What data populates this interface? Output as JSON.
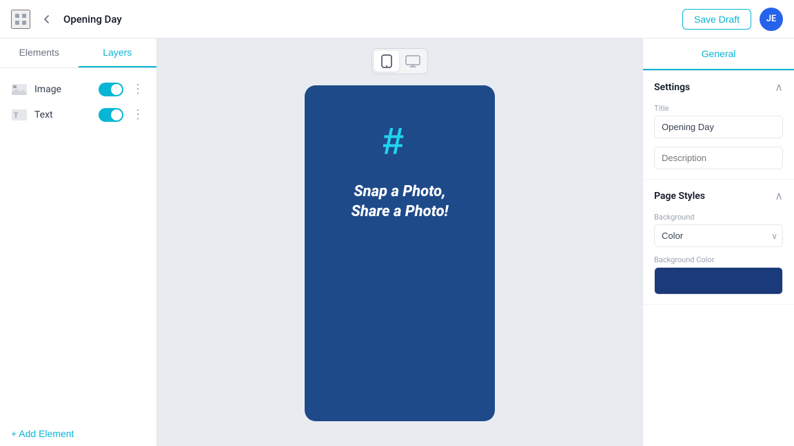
{
  "topbar": {
    "title": "Opening Day",
    "save_draft_label": "Save Draft",
    "avatar_initials": "JE"
  },
  "left_panel": {
    "tabs": [
      {
        "id": "elements",
        "label": "Elements"
      },
      {
        "id": "layers",
        "label": "Layers"
      }
    ],
    "active_tab": "layers",
    "layers": [
      {
        "id": "image",
        "name": "Image",
        "type": "image",
        "enabled": true
      },
      {
        "id": "text",
        "name": "Text",
        "type": "text",
        "enabled": true
      }
    ],
    "add_element_label": "+ Add Element"
  },
  "canvas": {
    "device_toolbar": [
      {
        "id": "mobile",
        "active": true
      },
      {
        "id": "desktop",
        "active": false
      }
    ],
    "phone": {
      "hash_symbol": "#",
      "headline_line1": "Snap a Photo,",
      "headline_line2": "Share a Photo!"
    }
  },
  "right_panel": {
    "active_tab": "General",
    "tabs": [
      "General"
    ],
    "settings_section": {
      "title": "Settings",
      "title_field_label": "Title",
      "title_field_value": "Opening Day",
      "description_field_label": "",
      "description_placeholder": "Description"
    },
    "page_styles_section": {
      "title": "Page Styles",
      "background_label": "Background",
      "background_value": "Color",
      "background_color_label": "Background Color",
      "background_color_hex": "#1a3a7a"
    }
  },
  "icons": {
    "grid": "⊞",
    "back_arrow": "←",
    "more_vertical": "⋮",
    "chevron_up": "∧",
    "chevron_down": "∨",
    "mobile": "📱",
    "desktop": "🖥"
  }
}
